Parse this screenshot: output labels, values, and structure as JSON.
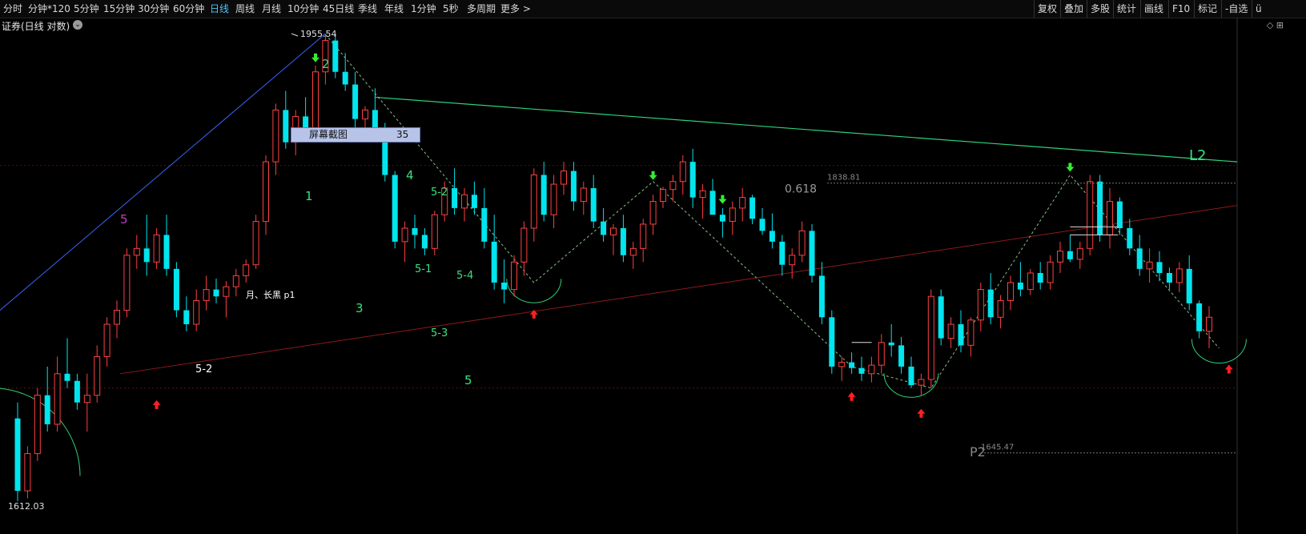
{
  "toolbar": {
    "left_items": [
      "分时",
      "分钟*120",
      "5分钟",
      "15分钟",
      "30分钟",
      "60分钟",
      "日线",
      "周线",
      "月线",
      "10分钟",
      "45日线",
      "季线",
      "年线",
      "1分钟",
      "5秒",
      "多周期",
      "更多 >"
    ],
    "active": "日线",
    "right_items": [
      "复权",
      "叠加",
      "多股",
      "统计",
      "画线",
      "F10",
      "标记",
      "-自选",
      "ü"
    ]
  },
  "subtitle": "证券(日线 对数)",
  "capture_popup": {
    "label": "屏幕截图",
    "value": "35"
  },
  "colors": {
    "up": "#ff4040",
    "down": "#00e5ee",
    "trend": "#2fd07a",
    "green_text": "#39e27d",
    "wave_blue": "#3c64ff",
    "wave_purple": "#c03cc0",
    "support_red": "#8b1a1a"
  },
  "chart_data": {
    "type": "candlestick",
    "scale": "log",
    "ylim": [
      1612.03,
      1955.54
    ],
    "price_labels": {
      "high": "1955.54",
      "low": "1612.03",
      "level_1838": "1838.81",
      "level_1645": "1645.47"
    },
    "annotations": {
      "fib": "0.618",
      "L2": "L2",
      "P2": "P2",
      "moon_label": "月、长黑 p1",
      "wave_labels": [
        "5",
        "2",
        "1",
        "3",
        "4",
        "5-2",
        "5-1",
        "5-4",
        "5-3",
        "5",
        "5-2"
      ]
    },
    "ohlc": [
      [
        1669,
        1680,
        1613,
        1620
      ],
      [
        1620,
        1650,
        1615,
        1645
      ],
      [
        1645,
        1690,
        1640,
        1685
      ],
      [
        1685,
        1705,
        1660,
        1665
      ],
      [
        1665,
        1712,
        1660,
        1700
      ],
      [
        1700,
        1725,
        1690,
        1695
      ],
      [
        1695,
        1700,
        1675,
        1680
      ],
      [
        1680,
        1700,
        1660,
        1685
      ],
      [
        1685,
        1720,
        1680,
        1712
      ],
      [
        1712,
        1740,
        1705,
        1735
      ],
      [
        1735,
        1752,
        1725,
        1745
      ],
      [
        1745,
        1790,
        1740,
        1785
      ],
      [
        1785,
        1800,
        1775,
        1790
      ],
      [
        1790,
        1815,
        1770,
        1780
      ],
      [
        1780,
        1805,
        1775,
        1800
      ],
      [
        1800,
        1815,
        1770,
        1775
      ],
      [
        1775,
        1780,
        1740,
        1745
      ],
      [
        1745,
        1755,
        1730,
        1735
      ],
      [
        1735,
        1760,
        1730,
        1752
      ],
      [
        1752,
        1770,
        1745,
        1760
      ],
      [
        1760,
        1768,
        1750,
        1755
      ],
      [
        1755,
        1766,
        1740,
        1762
      ],
      [
        1762,
        1775,
        1755,
        1770
      ],
      [
        1770,
        1782,
        1765,
        1778
      ],
      [
        1778,
        1815,
        1775,
        1810
      ],
      [
        1810,
        1860,
        1800,
        1855
      ],
      [
        1855,
        1900,
        1845,
        1895
      ],
      [
        1895,
        1910,
        1865,
        1870
      ],
      [
        1870,
        1895,
        1860,
        1890
      ],
      [
        1890,
        1905,
        1875,
        1880
      ],
      [
        1880,
        1930,
        1870,
        1925
      ],
      [
        1925,
        1955,
        1915,
        1950
      ],
      [
        1950,
        1955,
        1920,
        1925
      ],
      [
        1925,
        1940,
        1910,
        1915
      ],
      [
        1915,
        1925,
        1880,
        1888
      ],
      [
        1888,
        1898,
        1870,
        1895
      ],
      [
        1895,
        1912,
        1885,
        1880
      ],
      [
        1880,
        1885,
        1840,
        1845
      ],
      [
        1845,
        1848,
        1790,
        1795
      ],
      [
        1795,
        1810,
        1780,
        1805
      ],
      [
        1805,
        1815,
        1790,
        1800
      ],
      [
        1800,
        1805,
        1785,
        1790
      ],
      [
        1790,
        1818,
        1785,
        1815
      ],
      [
        1815,
        1840,
        1810,
        1835
      ],
      [
        1835,
        1850,
        1815,
        1820
      ],
      [
        1820,
        1835,
        1810,
        1830
      ],
      [
        1830,
        1840,
        1815,
        1820
      ],
      [
        1820,
        1835,
        1790,
        1795
      ],
      [
        1795,
        1815,
        1760,
        1765
      ],
      [
        1765,
        1782,
        1750,
        1760
      ],
      [
        1760,
        1785,
        1755,
        1780
      ],
      [
        1780,
        1810,
        1770,
        1805
      ],
      [
        1805,
        1850,
        1795,
        1845
      ],
      [
        1845,
        1855,
        1810,
        1815
      ],
      [
        1815,
        1845,
        1805,
        1838
      ],
      [
        1838,
        1855,
        1830,
        1848
      ],
      [
        1848,
        1855,
        1818,
        1825
      ],
      [
        1825,
        1840,
        1815,
        1835
      ],
      [
        1835,
        1845,
        1805,
        1810
      ],
      [
        1810,
        1820,
        1795,
        1800
      ],
      [
        1800,
        1808,
        1785,
        1805
      ],
      [
        1805,
        1815,
        1780,
        1785
      ],
      [
        1785,
        1795,
        1775,
        1790
      ],
      [
        1790,
        1812,
        1780,
        1808
      ],
      [
        1808,
        1830,
        1800,
        1825
      ],
      [
        1825,
        1836,
        1820,
        1834
      ],
      [
        1834,
        1845,
        1825,
        1840
      ],
      [
        1840,
        1860,
        1830,
        1855
      ],
      [
        1855,
        1865,
        1820,
        1828
      ],
      [
        1828,
        1838,
        1812,
        1833
      ],
      [
        1833,
        1842,
        1818,
        1815
      ],
      [
        1815,
        1820,
        1798,
        1810
      ],
      [
        1810,
        1825,
        1800,
        1820
      ],
      [
        1820,
        1835,
        1810,
        1828
      ],
      [
        1828,
        1830,
        1808,
        1812
      ],
      [
        1812,
        1820,
        1800,
        1803
      ],
      [
        1803,
        1816,
        1790,
        1795
      ],
      [
        1795,
        1800,
        1770,
        1778
      ],
      [
        1778,
        1790,
        1768,
        1785
      ],
      [
        1785,
        1810,
        1780,
        1803
      ],
      [
        1803,
        1808,
        1765,
        1770
      ],
      [
        1770,
        1780,
        1735,
        1740
      ],
      [
        1740,
        1745,
        1700,
        1705
      ],
      [
        1705,
        1712,
        1695,
        1708
      ],
      [
        1708,
        1715,
        1700,
        1704
      ],
      [
        1704,
        1712,
        1695,
        1700
      ],
      [
        1700,
        1712,
        1694,
        1706
      ],
      [
        1706,
        1728,
        1700,
        1722
      ],
      [
        1722,
        1735,
        1712,
        1720
      ],
      [
        1720,
        1726,
        1700,
        1705
      ],
      [
        1705,
        1712,
        1690,
        1692
      ],
      [
        1692,
        1700,
        1685,
        1696
      ],
      [
        1696,
        1760,
        1690,
        1755
      ],
      [
        1755,
        1760,
        1720,
        1725
      ],
      [
        1725,
        1740,
        1718,
        1735
      ],
      [
        1735,
        1745,
        1715,
        1720
      ],
      [
        1720,
        1740,
        1712,
        1738
      ],
      [
        1738,
        1765,
        1730,
        1760
      ],
      [
        1760,
        1772,
        1735,
        1740
      ],
      [
        1740,
        1756,
        1732,
        1752
      ],
      [
        1752,
        1770,
        1745,
        1765
      ],
      [
        1765,
        1780,
        1755,
        1760
      ],
      [
        1760,
        1775,
        1756,
        1772
      ],
      [
        1772,
        1780,
        1760,
        1765
      ],
      [
        1765,
        1785,
        1760,
        1780
      ],
      [
        1780,
        1795,
        1772,
        1788
      ],
      [
        1788,
        1800,
        1780,
        1782
      ],
      [
        1782,
        1795,
        1775,
        1790
      ],
      [
        1790,
        1845,
        1785,
        1840
      ],
      [
        1840,
        1845,
        1795,
        1800
      ],
      [
        1800,
        1835,
        1790,
        1825
      ],
      [
        1825,
        1828,
        1800,
        1805
      ],
      [
        1805,
        1812,
        1785,
        1790
      ],
      [
        1790,
        1800,
        1770,
        1775
      ],
      [
        1775,
        1790,
        1765,
        1780
      ],
      [
        1780,
        1788,
        1766,
        1772
      ],
      [
        1772,
        1776,
        1760,
        1765
      ],
      [
        1765,
        1780,
        1758,
        1775
      ],
      [
        1775,
        1785,
        1745,
        1750
      ],
      [
        1750,
        1752,
        1725,
        1730
      ],
      [
        1730,
        1748,
        1718,
        1740
      ]
    ],
    "wave_points_idx": [
      31,
      52,
      84,
      106,
      121
    ]
  }
}
